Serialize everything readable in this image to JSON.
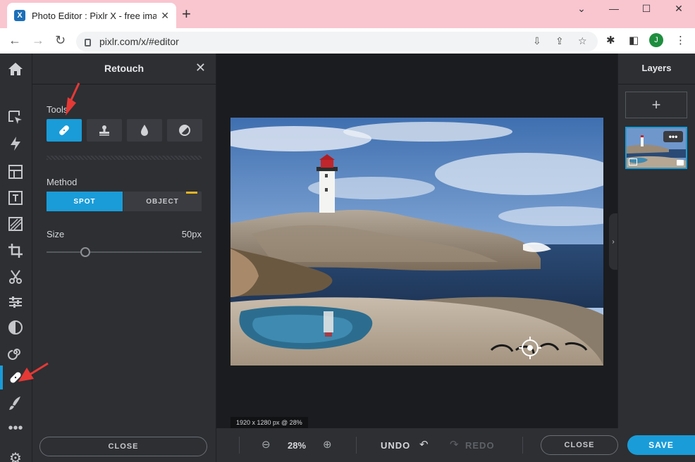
{
  "browser": {
    "tab_title": "Photo Editor : Pixlr X - free ima",
    "favicon_letter": "X",
    "url": "pixlr.com/x/#editor",
    "profile_initial": "J"
  },
  "panel": {
    "title": "Retouch",
    "tools_label": "Tools",
    "method_label": "Method",
    "method_spot": "SPOT",
    "method_object": "OBJECT",
    "size_label": "Size",
    "size_value": "50px",
    "close_label": "CLOSE"
  },
  "canvas": {
    "info": "1920 x 1280 px @ 28%"
  },
  "bottom": {
    "zoom": "28%",
    "undo": "UNDO",
    "redo": "REDO",
    "close": "CLOSE",
    "save": "SAVE"
  },
  "layers": {
    "title": "Layers"
  },
  "colors": {
    "accent": "#1a9cd8",
    "tab_strip": "#f9c5cf"
  }
}
